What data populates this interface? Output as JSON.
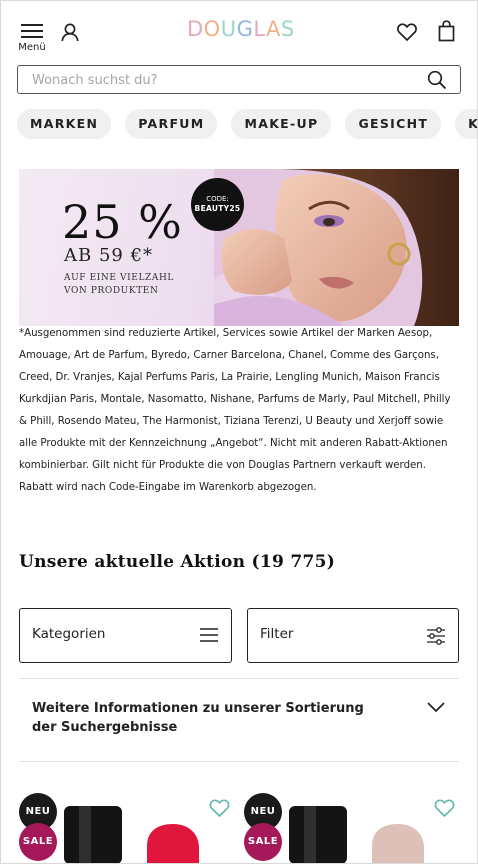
{
  "header": {
    "menu_label": "Menü",
    "logo_text": "DOUGLAS",
    "icons": [
      "hamburger-icon",
      "user-icon",
      "heart-icon",
      "shopping-bag-icon"
    ]
  },
  "search": {
    "placeholder": "Wonach suchst du?",
    "value": ""
  },
  "categories": [
    "MARKEN",
    "PARFUM",
    "MAKE-UP",
    "GESICHT",
    "KÖRPER"
  ],
  "banner": {
    "headline": "25 %",
    "sub": "AB 59 €*",
    "small_line1": "AUF EINE VIELZAHL",
    "small_line2": "VON PRODUKTEN",
    "code_label": "CODE:",
    "code_value": "BEAUTY25"
  },
  "disclaimer": "*Ausgenommen sind reduzierte Artikel, Services sowie Artikel der Marken Aesop, Amouage, Art de Parfum, Byredo, Carner Barcelona, Chanel, Comme des Garçons, Creed, Dr. Vranjes, Kajal Perfums Paris, La Prairie, Lengling Munich, Maison Francis Kurkdjian Paris, Montale, Nasomatto, Nishane, Parfums de Marly, Paul Mitchell, Philly & Phill, Rosendo Mateu, The Harmonist, Tiziana Terenzi, U Beauty und Xerjoff sowie alle Produkte mit der Kennzeichnung „Angebot“. Nicht mit anderen Rabatt-Aktionen kombinierbar. Gilt nicht für Produkte die von Douglas Partnern verkauft werden. Rabatt wird nach Code-Eingabe im Warenkorb abgezogen.",
  "listing": {
    "heading": "Unsere aktuelle Aktion (19 775)",
    "categories_button": "Kategorien",
    "filter_button": "Filter",
    "sort_info": "Weitere Informationen zu unserer Sortierung der Suchergebnisse"
  },
  "products": [
    {
      "badge_new": "NEU",
      "badge_sale": "SALE",
      "color": "#e0163c"
    },
    {
      "badge_new": "NEU",
      "badge_sale": "SALE",
      "color": "#ddc0b8"
    }
  ],
  "colors": {
    "sale": "#a5195a",
    "accent_heart": "#5fb8aa"
  }
}
